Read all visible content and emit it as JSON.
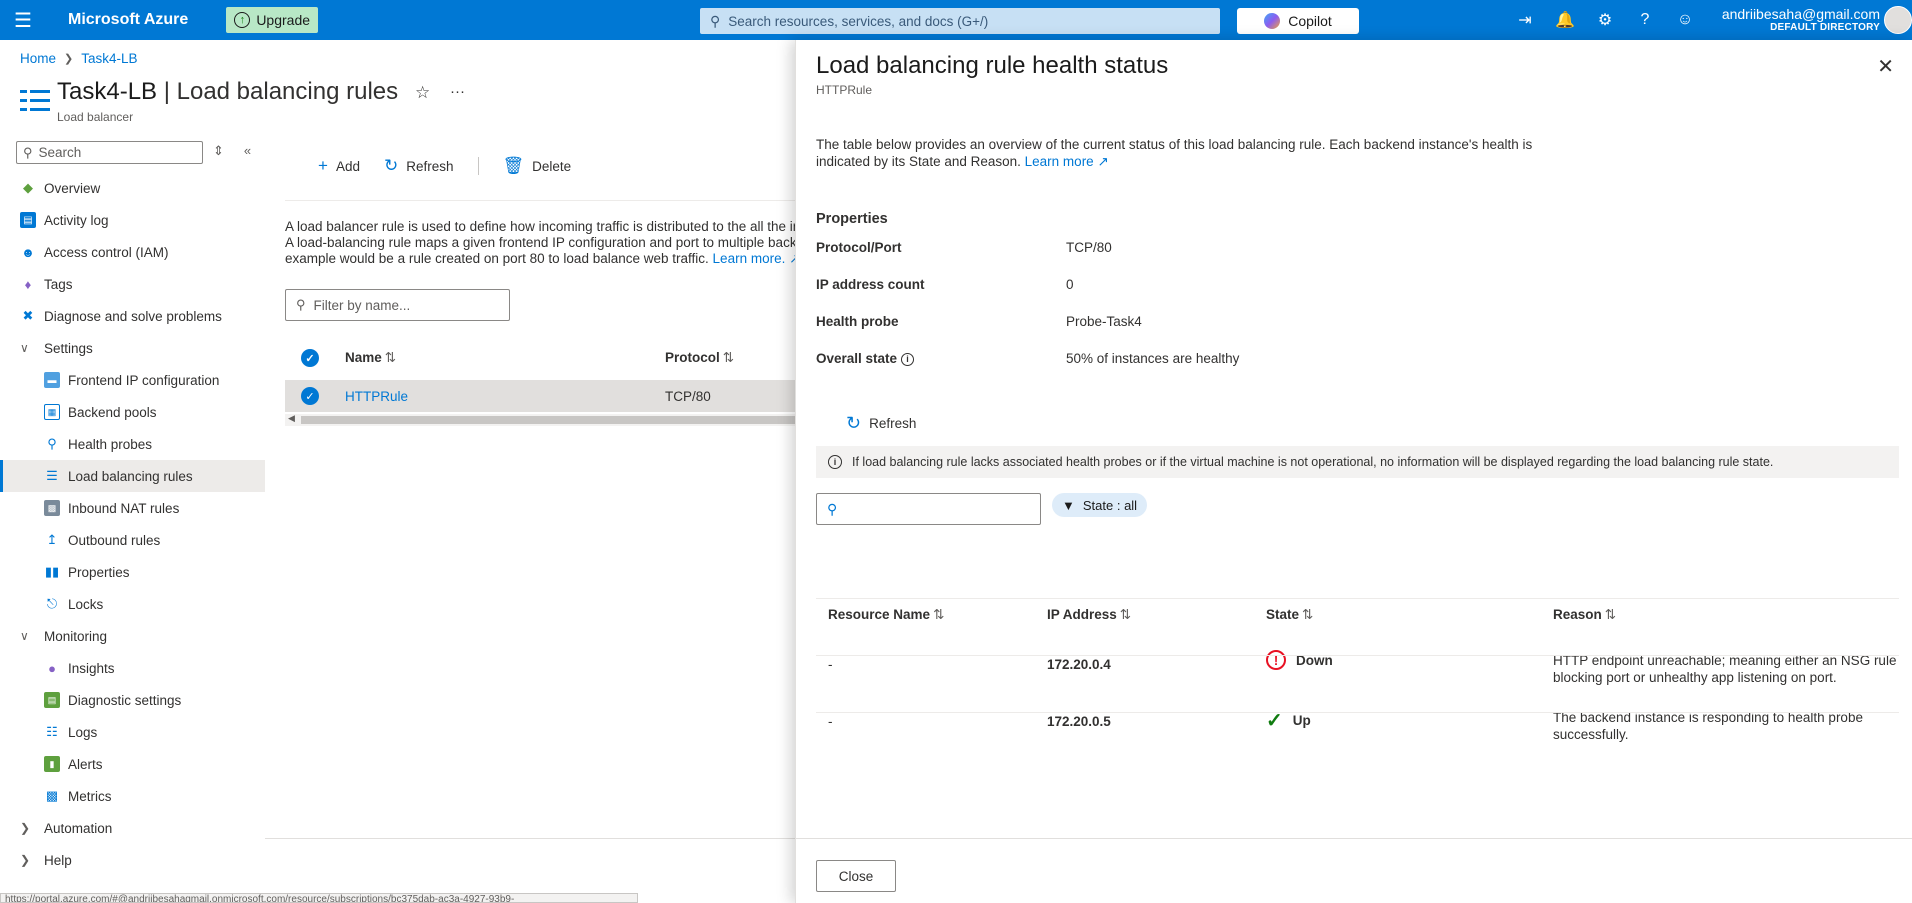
{
  "topbar": {
    "brand": "Microsoft Azure",
    "upgrade_label": "Upgrade",
    "search_placeholder": "Search resources, services, and docs (G+/)",
    "copilot_label": "Copilot",
    "account_email": "andriibesaha@gmail.com",
    "account_directory": "DEFAULT DIRECTORY"
  },
  "breadcrumb": {
    "home": "Home",
    "resource": "Task4-LB"
  },
  "header": {
    "resource_name": "Task4-LB",
    "separator": " | ",
    "page_name": "Load balancing rules",
    "resource_type": "Load balancer"
  },
  "sidebar": {
    "search_placeholder": "Search",
    "items": [
      {
        "label": "Overview",
        "icon": "overview-icon",
        "level": 0
      },
      {
        "label": "Activity log",
        "icon": "activity-log-icon",
        "level": 0
      },
      {
        "label": "Access control (IAM)",
        "icon": "iam-icon",
        "level": 0
      },
      {
        "label": "Tags",
        "icon": "tag-icon",
        "level": 0
      },
      {
        "label": "Diagnose and solve problems",
        "icon": "diagnose-icon",
        "level": 0
      },
      {
        "label": "Settings",
        "group": true,
        "expanded": true
      },
      {
        "label": "Frontend IP configuration",
        "icon": "frontend-ip-icon",
        "level": 1
      },
      {
        "label": "Backend pools",
        "icon": "backend-pools-icon",
        "level": 1
      },
      {
        "label": "Health probes",
        "icon": "health-probe-icon",
        "level": 1
      },
      {
        "label": "Load balancing rules",
        "icon": "lb-rules-icon",
        "level": 1,
        "selected": true
      },
      {
        "label": "Inbound NAT rules",
        "icon": "inbound-nat-icon",
        "level": 1
      },
      {
        "label": "Outbound rules",
        "icon": "outbound-icon",
        "level": 1
      },
      {
        "label": "Properties",
        "icon": "properties-icon",
        "level": 1
      },
      {
        "label": "Locks",
        "icon": "lock-icon",
        "level": 1
      },
      {
        "label": "Monitoring",
        "group": true,
        "expanded": true
      },
      {
        "label": "Insights",
        "icon": "insights-icon",
        "level": 1
      },
      {
        "label": "Diagnostic settings",
        "icon": "diagnostic-settings-icon",
        "level": 1
      },
      {
        "label": "Logs",
        "icon": "logs-icon",
        "level": 1
      },
      {
        "label": "Alerts",
        "icon": "alerts-icon",
        "level": 1
      },
      {
        "label": "Metrics",
        "icon": "metrics-icon",
        "level": 1
      },
      {
        "label": "Automation",
        "group": true,
        "expanded": false
      },
      {
        "label": "Help",
        "group": true,
        "expanded": false
      }
    ]
  },
  "commands": {
    "add": "Add",
    "refresh": "Refresh",
    "delete": "Delete"
  },
  "main": {
    "description_line1": "A load balancer rule is used to define how incoming traffic is distributed to the all the inst",
    "description_line2": "A load-balancing rule maps a given frontend IP configuration and port to multiple backer",
    "description_line3": "example would be a rule created on port 80 to load balance web traffic.",
    "learn_more": "Learn more.",
    "filter_placeholder": "Filter by name...",
    "columns": {
      "name": "Name",
      "protocol": "Protocol"
    },
    "rows": [
      {
        "name": "HTTPRule",
        "protocol": "TCP/80"
      }
    ]
  },
  "status_url": "https://portal.azure.com/#@andriibesahagmail.onmicrosoft.com/resource/subscriptions/bc375dab-ac3a-4927-93b9-",
  "panel": {
    "title": "Load balancing rule health status",
    "subtitle": "HTTPRule",
    "description": "The table below provides an overview of the current status of this load balancing rule. Each backend instance's health is indicated by its State and Reason.",
    "learn_more": "Learn more",
    "properties_heading": "Properties",
    "properties": [
      {
        "key": "Protocol/Port",
        "value": "TCP/80"
      },
      {
        "key": "IP address count",
        "value": "0"
      },
      {
        "key": "Health probe",
        "value": "Probe-Task4"
      },
      {
        "key": "Overall state",
        "value": "50% of instances are healthy",
        "info": true
      }
    ],
    "refresh_label": "Refresh",
    "info_message": "If load balancing rule lacks associated health probes or if the virtual machine is not operational, no information will be displayed regarding the load balancing rule state.",
    "state_filter": "State : all",
    "columns": {
      "resource": "Resource Name",
      "ip": "IP Address",
      "state": "State",
      "reason": "Reason"
    },
    "rows": [
      {
        "resource": "-",
        "ip": "172.20.0.4",
        "state": "Down",
        "reason_line1": "HTTP endpoint unreachable; meaning either an NSG rule",
        "reason_line2": "blocking port or unhealthy app listening on port."
      },
      {
        "resource": "-",
        "ip": "172.20.0.5",
        "state": "Up",
        "reason_line1": "The backend instance is responding to health probe",
        "reason_line2": "successfully."
      }
    ],
    "close_label": "Close"
  },
  "colors": {
    "accent": "#0078d4",
    "down": "#e81123",
    "up": "#107c10"
  }
}
